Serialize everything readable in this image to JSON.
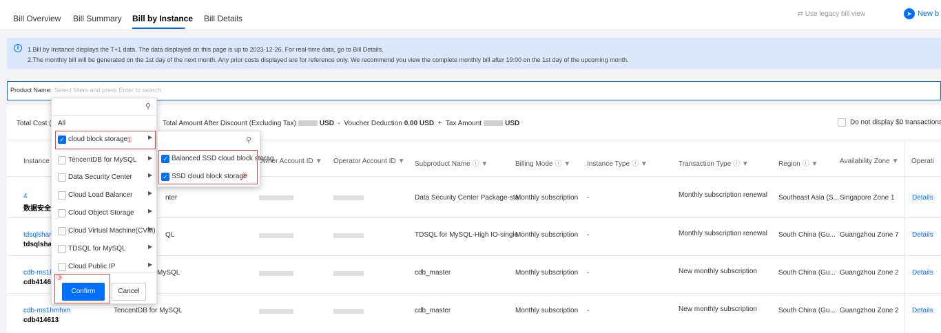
{
  "tabs": [
    "Bill Overview",
    "Bill Summary",
    "Bill by Instance",
    "Bill Details"
  ],
  "header": {
    "legacy": "Use legacy bill view",
    "new_bill": "New b"
  },
  "notice": {
    "line1": "1.Bill by Instance displays the T+1 data. The data displayed on this page is up to 2023-12-26. For real-time data, go to Bill Details.",
    "line2": "2.The monthly bill will be generated on the 1st day of the next month. Any prior costs displayed are for reference only. We recommend you view the complete monthly bill after 19:00 on the 1st day of the upcoming month."
  },
  "filter": {
    "label": "Product Name:",
    "placeholder": "Select filters and press Enter to search"
  },
  "summary": {
    "total_cost": "Total Cost (I",
    "after_discount": "Total Amount After Discount (Excluding Tax)",
    "currency": "USD",
    "voucher_label": "Voucher Deduction",
    "voucher_value": "0.00 USD",
    "tax_label": "Tax Amount",
    "zero_toggle": "Do not display $0 transactions"
  },
  "columns": [
    "Instance II",
    "Owner Account ID",
    "Operator Account ID",
    "Subproduct Name",
    "Billing Mode",
    "Instance Type",
    "Transaction Type",
    "Region",
    "Availability Zone",
    "Operati"
  ],
  "rows": [
    {
      "id1": "4",
      "id2": "数据安全中",
      "product": "nter",
      "sub": "Data Security Center Package-sta",
      "billing": "Monthly subscription",
      "type": "-",
      "txn": "Monthly subscription renewal",
      "region": "Southeast Asia (S...",
      "zone": "Singapore Zone 1",
      "op": "Details"
    },
    {
      "id1": "tdsqlshard-",
      "id2": "tdsqlshard",
      "product": "QL",
      "sub": "TDSQL for MySQL-High IO-single",
      "billing": "Monthly subscription",
      "type": "-",
      "txn": "Monthly subscription renewal",
      "region": "South China (Gu...",
      "zone": "Guangzhou Zone 7",
      "op": "Details"
    },
    {
      "id1": "cdb-ms1hr",
      "id2": "cdb414612",
      "product": "MySQL",
      "sub": "cdb_master",
      "billing": "Monthly subscription",
      "type": "-",
      "txn": "New monthly subscription",
      "region": "South China (Gu...",
      "zone": "Guangzhou Zone 2",
      "op": "Details"
    },
    {
      "id1": "cdb-ms1hmhxn",
      "id2": "cdb414613",
      "product": "TencentDB for MySQL",
      "sub": "cdb_master",
      "billing": "Monthly subscription",
      "type": "-",
      "txn": "New monthly subscription",
      "region": "South China (Gu...",
      "zone": "Guangzhou Zone 2",
      "op": "Details"
    }
  ],
  "dropdown": {
    "all": "All",
    "items": [
      "cloud block storage",
      "TencentDB for MySQL",
      "Data Security Center",
      "Cloud Load Balancer",
      "Cloud Object Storage",
      "Cloud Virtual Machine(CVM)",
      "TDSQL for MySQL",
      "Cloud Public IP"
    ],
    "confirm": "Confirm",
    "cancel": "Cancel"
  },
  "subdropdown": {
    "items": [
      "Balanced SSD cloud block storag",
      "SSD cloud block storage"
    ]
  },
  "markers": [
    "①",
    "②",
    "③"
  ],
  "colors": {
    "accent": "#006eff",
    "annotation": "#e54545",
    "notice_bg": "#dbe7fb"
  }
}
